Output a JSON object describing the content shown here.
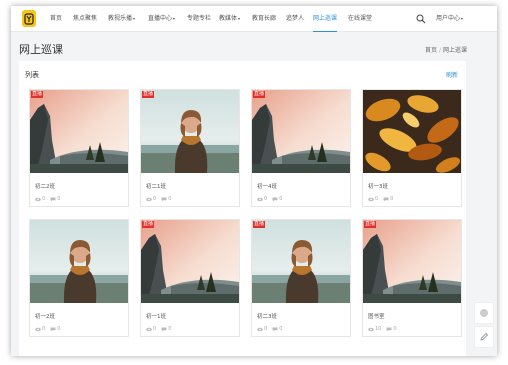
{
  "nav": {
    "items": [
      {
        "label": "首页",
        "caret": false,
        "active": false
      },
      {
        "label": "焦点聚焦",
        "caret": false,
        "active": false
      },
      {
        "label": "教视乐播",
        "caret": true,
        "active": false
      },
      {
        "label": "直播中心",
        "caret": true,
        "active": false
      },
      {
        "label": "专题专栏",
        "caret": false,
        "active": false
      },
      {
        "label": "教媒体",
        "caret": true,
        "active": false
      },
      {
        "label": "教育长廊",
        "caret": false,
        "active": false
      },
      {
        "label": "追梦人",
        "caret": false,
        "active": false
      },
      {
        "label": "网上巡课",
        "caret": false,
        "active": true
      },
      {
        "label": "在线课堂",
        "caret": false,
        "active": false
      }
    ],
    "user_center": "用户中心",
    "caret_glyph": "▾"
  },
  "page": {
    "title": "网上巡课",
    "breadcrumb": [
      "首页",
      "网上巡课"
    ]
  },
  "panel": {
    "title": "列表",
    "link": "刷新"
  },
  "cards": [
    {
      "title": "初二2班",
      "badge": "直播",
      "image": "cliff",
      "views": "0",
      "comments": "0"
    },
    {
      "title": "初二1班",
      "badge": "直播",
      "image": "person",
      "views": "0",
      "comments": "0"
    },
    {
      "title": "初一4班",
      "badge": "直播",
      "image": "cliff",
      "views": "0",
      "comments": "0"
    },
    {
      "title": "初一3班",
      "badge": "",
      "image": "leaves",
      "views": "0",
      "comments": "0"
    },
    {
      "title": "初一2班",
      "badge": "",
      "image": "person",
      "views": "0",
      "comments": "0"
    },
    {
      "title": "初一1班",
      "badge": "直播",
      "image": "cliff",
      "views": "0",
      "comments": "0"
    },
    {
      "title": "初二3班",
      "badge": "直播",
      "image": "person",
      "views": "0",
      "comments": "0"
    },
    {
      "title": "图书室",
      "badge": "直播",
      "image": "cliff",
      "views": "10",
      "comments": "0"
    }
  ]
}
